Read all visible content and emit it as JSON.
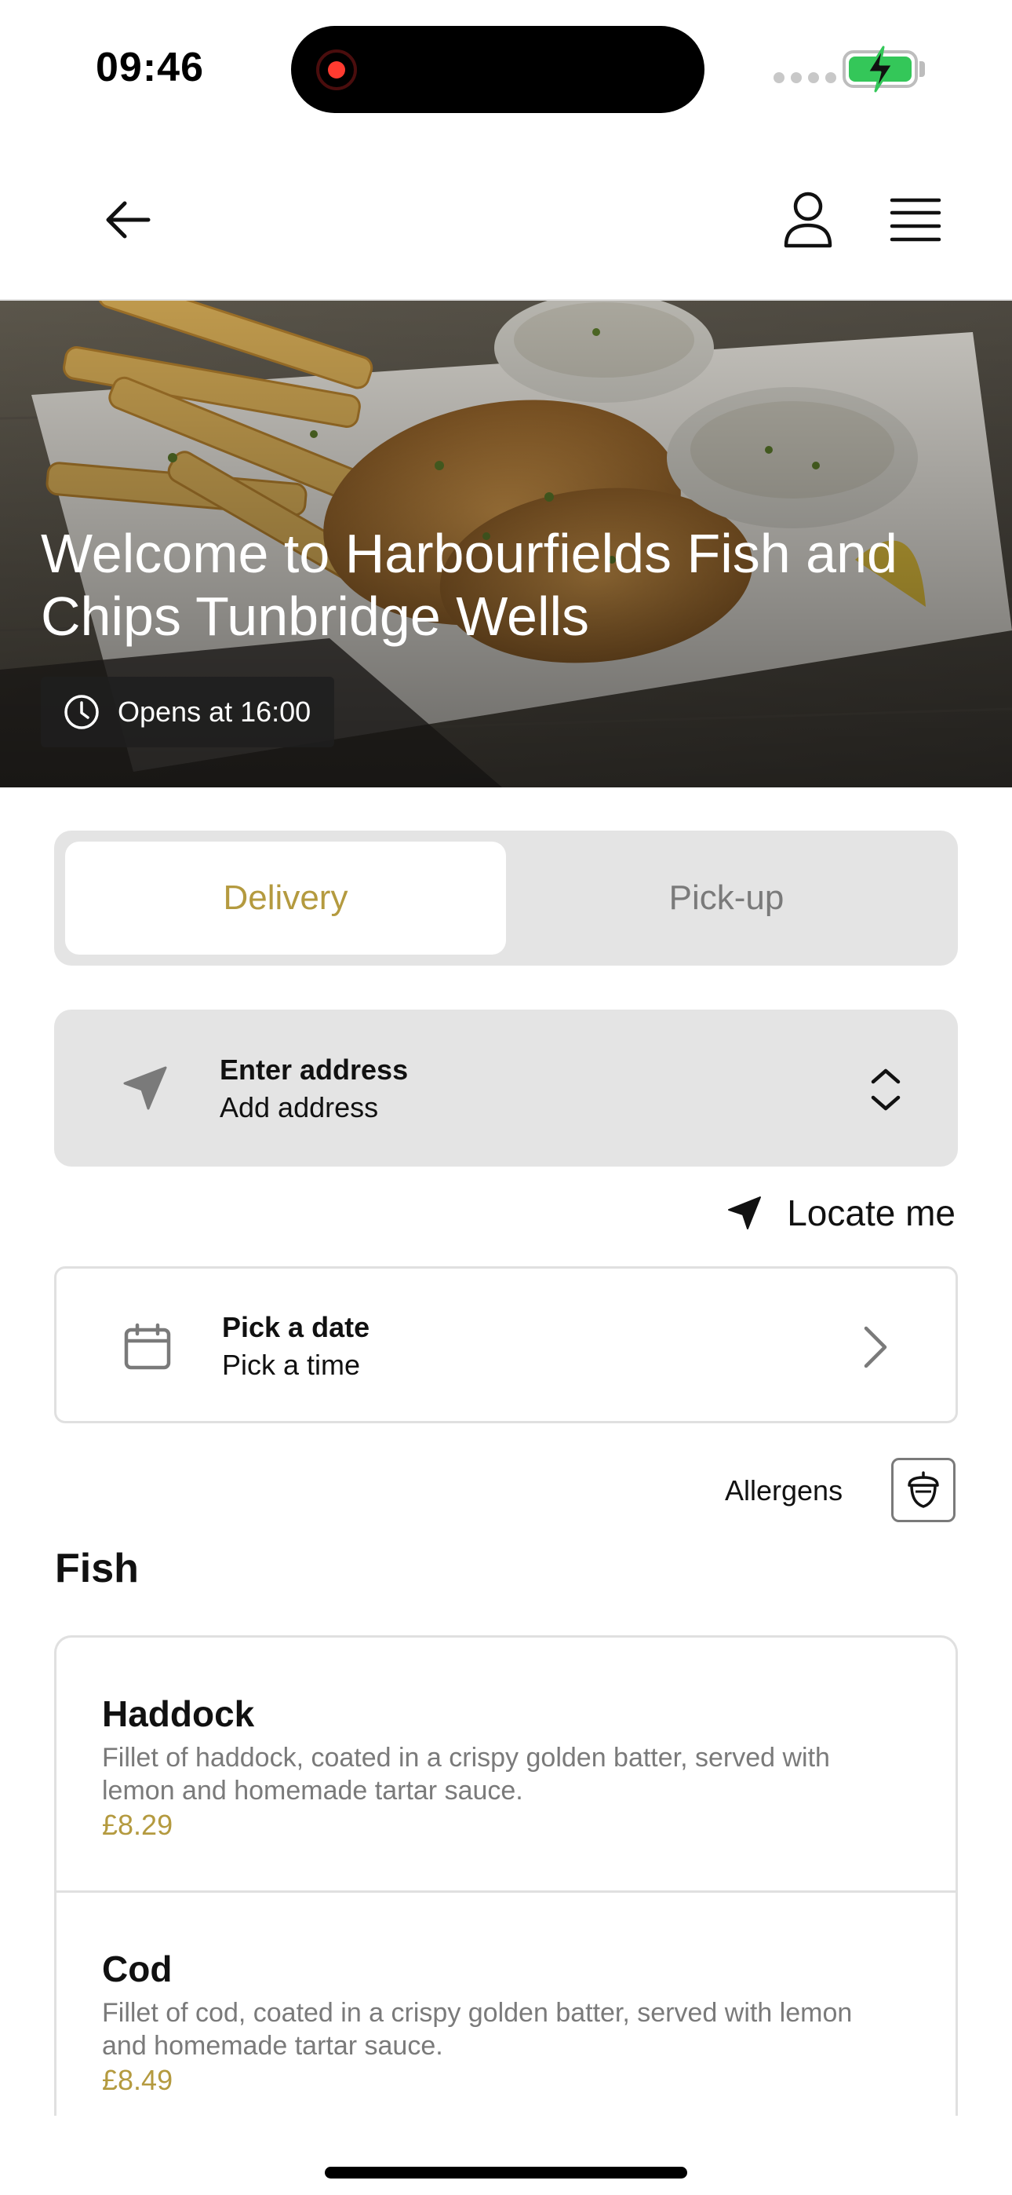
{
  "status_bar": {
    "time": "09:46"
  },
  "nav": {
    "back_icon": "arrow-left-icon",
    "account_icon": "user-icon",
    "menu_icon": "hamburger-icon"
  },
  "hero": {
    "title": "Welcome to Harbourfields Fish and Chips Tunbridge Wells",
    "opens_label": "Opens at 16:00"
  },
  "tabs": [
    {
      "label": "Delivery",
      "active": true
    },
    {
      "label": "Pick-up",
      "active": false
    }
  ],
  "address": {
    "title": "Enter address",
    "subtitle": "Add address",
    "icon": "location-arrow-icon"
  },
  "locate": {
    "label": "Locate me"
  },
  "schedule": {
    "title": "Pick a date",
    "subtitle": "Pick a time",
    "icon": "calendar-icon"
  },
  "allergens": {
    "label": "Allergens",
    "icon": "acorn-icon"
  },
  "section": {
    "title": "Fish"
  },
  "menu_items": [
    {
      "name": "Haddock",
      "description": "Fillet of haddock, coated in a crispy golden batter, served with lemon and homemade tartar sauce.",
      "price": "£8.29"
    },
    {
      "name": "Cod",
      "description": "Fillet of cod, coated in a crispy golden batter, served with lemon and homemade tartar sauce.",
      "price": "£8.49"
    }
  ],
  "colors": {
    "accent": "#b49a3f",
    "muted_text": "#7a7a7a",
    "card_bg": "#e4e4e4",
    "battery_green": "#34c759",
    "record_red": "#ff3b30"
  }
}
